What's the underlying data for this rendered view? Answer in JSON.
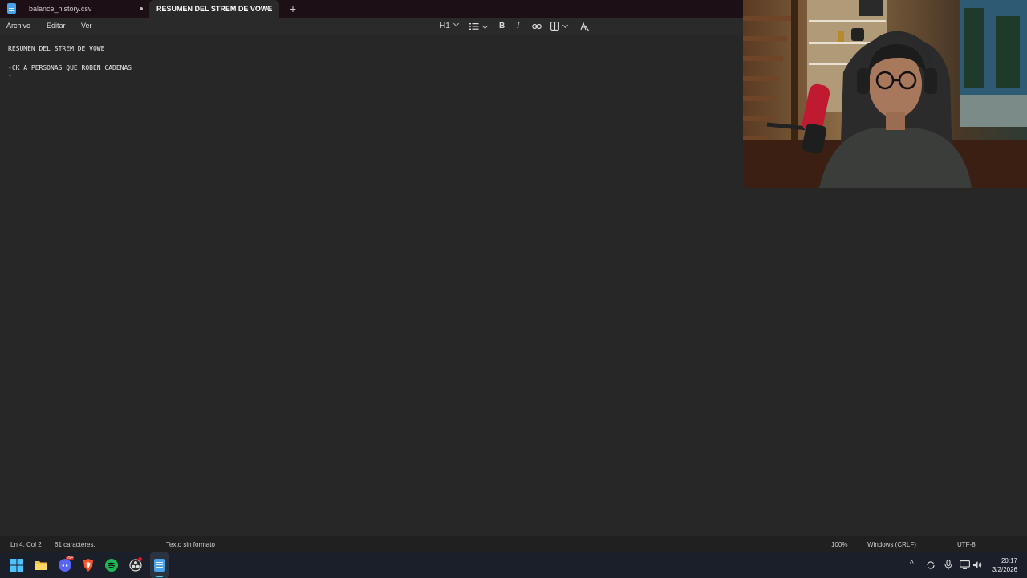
{
  "tabs": [
    {
      "title": "balance_history.csv",
      "modified": true
    },
    {
      "title": "RESUMEN DEL STREM DE VOWE",
      "modified": true,
      "active": true
    }
  ],
  "menu": {
    "file": "Archivo",
    "edit": "Editar",
    "view": "Ver"
  },
  "toolbar": {
    "heading": "H1",
    "bold": "B",
    "italic": "I"
  },
  "document": {
    "lines": [
      "RESUMEN DEL STREM DE VOWE",
      "",
      "-CK A PERSONAS QUE ROBEN CADENAS",
      "-"
    ]
  },
  "status": {
    "position": "Ln 4, Col 2",
    "chars": "61 caracteres.",
    "format": "Texto sin formato",
    "zoom": "100%",
    "line_ending": "Windows (CRLF)",
    "encoding": "UTF-8"
  },
  "taskbar": {
    "discord_badge": "99+",
    "time": "20:17",
    "date": "3/2/2026"
  },
  "colors": {
    "accent": "#4aa3e8",
    "titlebar": "#1c1016",
    "editor_bg": "#272727"
  }
}
